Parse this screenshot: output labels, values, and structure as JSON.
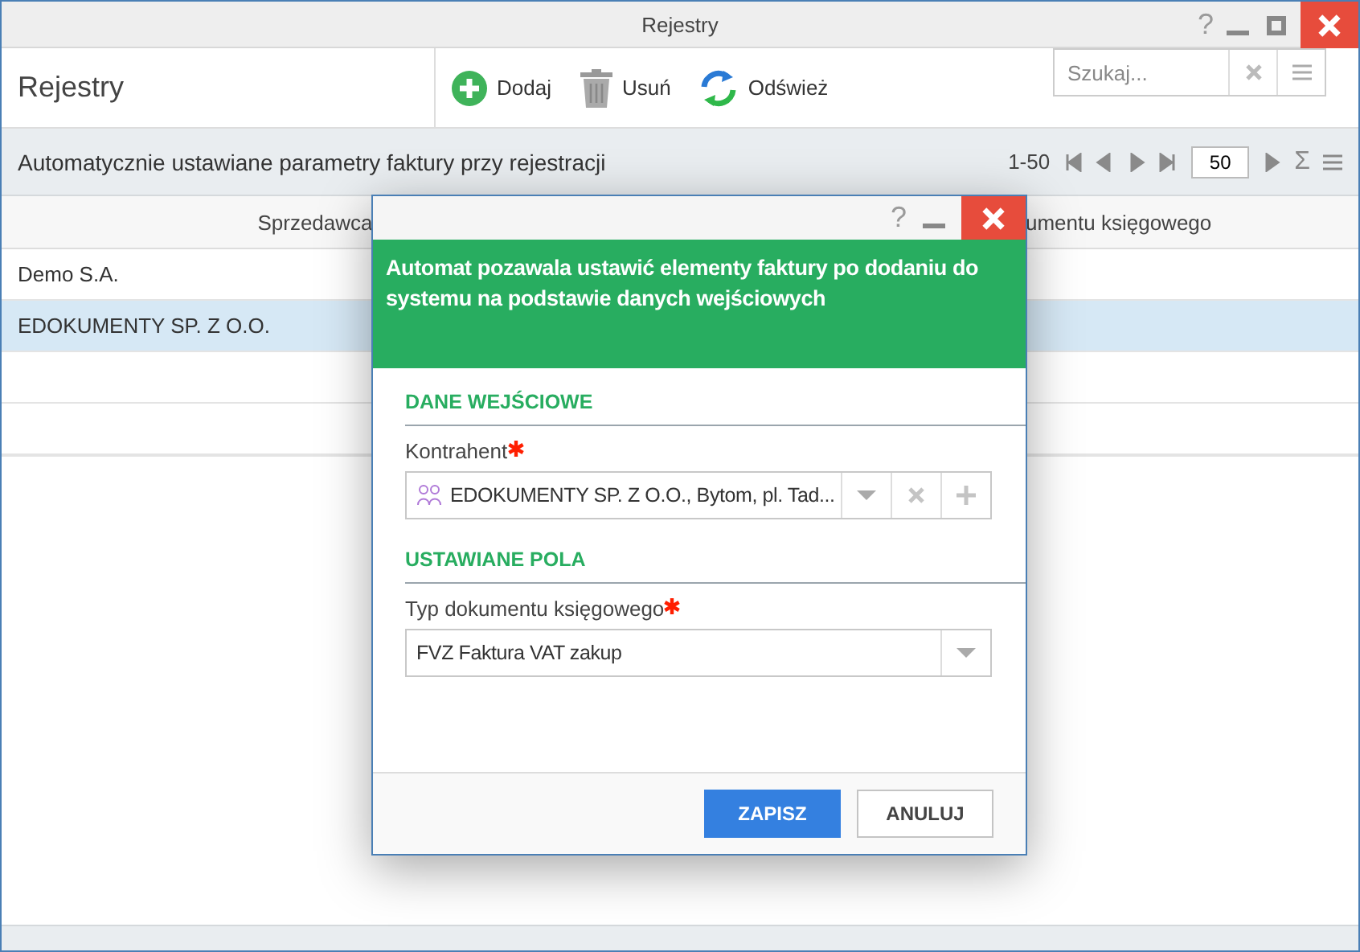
{
  "window": {
    "title": "Rejestry",
    "help": "?"
  },
  "toolbar": {
    "title": "Rejestry",
    "buttons": [
      {
        "kind": "add",
        "label": "Dodaj"
      },
      {
        "kind": "delete",
        "label": "Usuń"
      },
      {
        "kind": "refresh",
        "label": "Odśwież"
      }
    ],
    "search": {
      "placeholder": "Szukaj..."
    }
  },
  "grid": {
    "title": "Automatycznie ustawiane parametry faktury przy rejestracji",
    "range": "1-50",
    "page_size": "50",
    "sum": "Σ",
    "columns": [
      "Sprzedawca",
      "umentu księgowego"
    ],
    "rows": [
      {
        "cells": [
          "Demo S.A."
        ],
        "selected": false
      },
      {
        "cells": [
          "EDOKUMENTY SP. Z O.O."
        ],
        "selected": true
      }
    ]
  },
  "dialog": {
    "help": "?",
    "banner": "Automat pozawala ustawić elementy faktury po dodaniu do systemu na podstawie danych wejściowych",
    "sections": [
      {
        "title": "DANE WEJŚCIOWE",
        "fields": [
          {
            "kind": "lookup",
            "label": "Kontrahent",
            "required": true,
            "value": "EDOKUMENTY SP. Z O.O., Bytom, pl. Tad..."
          }
        ]
      },
      {
        "title": "USTAWIANE POLA",
        "fields": [
          {
            "kind": "select",
            "label": "Typ dokumentu księgowego",
            "required": true,
            "value": "FVZ Faktura VAT zakup"
          }
        ]
      }
    ],
    "buttons": [
      {
        "label": "ZAPISZ",
        "primary": true
      },
      {
        "label": "ANULUJ",
        "primary": false
      }
    ]
  }
}
